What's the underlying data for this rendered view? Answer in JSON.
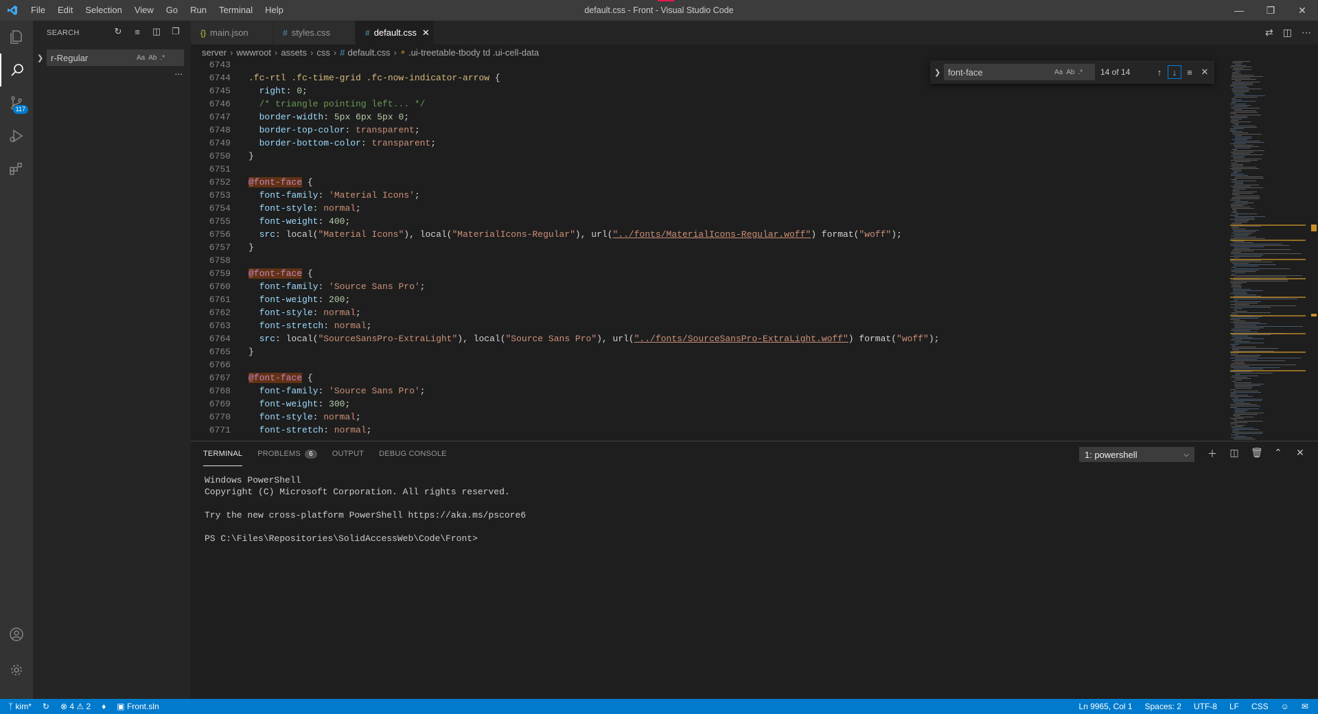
{
  "window": {
    "title": "default.css - Front - Visual Studio Code",
    "menu": [
      "File",
      "Edit",
      "Selection",
      "View",
      "Go",
      "Run",
      "Terminal",
      "Help"
    ]
  },
  "activity_bar": {
    "source_control_badge": "117"
  },
  "sidebar": {
    "header": "SEARCH",
    "search_value": "r-Regular",
    "option_case": "Aa",
    "option_word": "Ab",
    "option_regex": ".*",
    "more": "..."
  },
  "tabs": [
    {
      "label": "main.json",
      "icon": "{}"
    },
    {
      "label": "styles.css",
      "icon": "#"
    },
    {
      "label": "default.css",
      "icon": "#"
    }
  ],
  "breadcrumb": {
    "items": [
      "server",
      "wwwroot",
      "assets",
      "css",
      "default.css",
      ".ui-treetable-tbody td .ui-cell-data"
    ]
  },
  "find_widget": {
    "value": "font-face",
    "count": "14 of 14",
    "option_case": "Aa",
    "option_word": "Ab",
    "option_regex": ".*"
  },
  "editor": {
    "lines": [
      {
        "n": "6743",
        "tokens": []
      },
      {
        "n": "6744",
        "tokens": [
          [
            "sel",
            ".fc-rtl .fc-time-grid .fc-now-indicator-arrow"
          ],
          [
            "pun",
            " {"
          ]
        ]
      },
      {
        "n": "6745",
        "tokens": [
          [
            "pun",
            "  "
          ],
          [
            "prop",
            "right"
          ],
          [
            "pun",
            ": "
          ],
          [
            "num",
            "0"
          ],
          [
            "pun",
            ";"
          ]
        ]
      },
      {
        "n": "6746",
        "tokens": [
          [
            "pun",
            "  "
          ],
          [
            "cmt",
            "/* triangle pointing left... */"
          ]
        ]
      },
      {
        "n": "6747",
        "tokens": [
          [
            "pun",
            "  "
          ],
          [
            "prop",
            "border-width"
          ],
          [
            "pun",
            ": "
          ],
          [
            "num",
            "5px 6px 5px 0"
          ],
          [
            "pun",
            ";"
          ]
        ]
      },
      {
        "n": "6748",
        "tokens": [
          [
            "pun",
            "  "
          ],
          [
            "prop",
            "border-top-color"
          ],
          [
            "pun",
            ": "
          ],
          [
            "str",
            "transparent"
          ],
          [
            "pun",
            ";"
          ]
        ]
      },
      {
        "n": "6749",
        "tokens": [
          [
            "pun",
            "  "
          ],
          [
            "prop",
            "border-bottom-color"
          ],
          [
            "pun",
            ": "
          ],
          [
            "str",
            "transparent"
          ],
          [
            "pun",
            ";"
          ]
        ]
      },
      {
        "n": "6750",
        "tokens": [
          [
            "pun",
            "}"
          ]
        ]
      },
      {
        "n": "6751",
        "tokens": []
      },
      {
        "n": "6752",
        "tokens": [
          [
            "at",
            "@font-face"
          ],
          [
            "pun",
            " {"
          ]
        ]
      },
      {
        "n": "6753",
        "tokens": [
          [
            "pun",
            "  "
          ],
          [
            "prop",
            "font-family"
          ],
          [
            "pun",
            ": "
          ],
          [
            "str",
            "'Material Icons'"
          ],
          [
            "pun",
            ";"
          ]
        ]
      },
      {
        "n": "6754",
        "tokens": [
          [
            "pun",
            "  "
          ],
          [
            "prop",
            "font-style"
          ],
          [
            "pun",
            ": "
          ],
          [
            "str",
            "normal"
          ],
          [
            "pun",
            ";"
          ]
        ]
      },
      {
        "n": "6755",
        "tokens": [
          [
            "pun",
            "  "
          ],
          [
            "prop",
            "font-weight"
          ],
          [
            "pun",
            ": "
          ],
          [
            "num",
            "400"
          ],
          [
            "pun",
            ";"
          ]
        ]
      },
      {
        "n": "6756",
        "tokens": [
          [
            "pun",
            "  "
          ],
          [
            "prop",
            "src"
          ],
          [
            "pun",
            ": local("
          ],
          [
            "str",
            "\"Material Icons\""
          ],
          [
            "pun",
            "), local("
          ],
          [
            "str",
            "\"MaterialIcons-Regular\""
          ],
          [
            "pun",
            "), url("
          ],
          [
            "url",
            "\"../fonts/MaterialIcons-Regular.woff\""
          ],
          [
            "pun",
            ") format("
          ],
          [
            "str",
            "\"woff\""
          ],
          [
            "pun",
            ");"
          ]
        ]
      },
      {
        "n": "6757",
        "tokens": [
          [
            "pun",
            "}"
          ]
        ]
      },
      {
        "n": "6758",
        "tokens": []
      },
      {
        "n": "6759",
        "tokens": [
          [
            "at",
            "@font-face"
          ],
          [
            "pun",
            " {"
          ]
        ]
      },
      {
        "n": "6760",
        "tokens": [
          [
            "pun",
            "  "
          ],
          [
            "prop",
            "font-family"
          ],
          [
            "pun",
            ": "
          ],
          [
            "str",
            "'Source Sans Pro'"
          ],
          [
            "pun",
            ";"
          ]
        ]
      },
      {
        "n": "6761",
        "tokens": [
          [
            "pun",
            "  "
          ],
          [
            "prop",
            "font-weight"
          ],
          [
            "pun",
            ": "
          ],
          [
            "num",
            "200"
          ],
          [
            "pun",
            ";"
          ]
        ]
      },
      {
        "n": "6762",
        "tokens": [
          [
            "pun",
            "  "
          ],
          [
            "prop",
            "font-style"
          ],
          [
            "pun",
            ": "
          ],
          [
            "str",
            "normal"
          ],
          [
            "pun",
            ";"
          ]
        ]
      },
      {
        "n": "6763",
        "tokens": [
          [
            "pun",
            "  "
          ],
          [
            "prop",
            "font-stretch"
          ],
          [
            "pun",
            ": "
          ],
          [
            "str",
            "normal"
          ],
          [
            "pun",
            ";"
          ]
        ]
      },
      {
        "n": "6764",
        "tokens": [
          [
            "pun",
            "  "
          ],
          [
            "prop",
            "src"
          ],
          [
            "pun",
            ": local("
          ],
          [
            "str",
            "\"SourceSansPro-ExtraLight\""
          ],
          [
            "pun",
            "), local("
          ],
          [
            "str",
            "\"Source Sans Pro\""
          ],
          [
            "pun",
            "), url("
          ],
          [
            "url",
            "\"../fonts/SourceSansPro-ExtraLight.woff\""
          ],
          [
            "pun",
            ") format("
          ],
          [
            "str",
            "\"woff\""
          ],
          [
            "pun",
            ");"
          ]
        ]
      },
      {
        "n": "6765",
        "tokens": [
          [
            "pun",
            "}"
          ]
        ]
      },
      {
        "n": "6766",
        "tokens": []
      },
      {
        "n": "6767",
        "tokens": [
          [
            "at",
            "@font-face"
          ],
          [
            "pun",
            " {"
          ]
        ]
      },
      {
        "n": "6768",
        "tokens": [
          [
            "pun",
            "  "
          ],
          [
            "prop",
            "font-family"
          ],
          [
            "pun",
            ": "
          ],
          [
            "str",
            "'Source Sans Pro'"
          ],
          [
            "pun",
            ";"
          ]
        ]
      },
      {
        "n": "6769",
        "tokens": [
          [
            "pun",
            "  "
          ],
          [
            "prop",
            "font-weight"
          ],
          [
            "pun",
            ": "
          ],
          [
            "num",
            "300"
          ],
          [
            "pun",
            ";"
          ]
        ]
      },
      {
        "n": "6770",
        "tokens": [
          [
            "pun",
            "  "
          ],
          [
            "prop",
            "font-style"
          ],
          [
            "pun",
            ": "
          ],
          [
            "str",
            "normal"
          ],
          [
            "pun",
            ";"
          ]
        ]
      },
      {
        "n": "6771",
        "tokens": [
          [
            "pun",
            "  "
          ],
          [
            "prop",
            "font-stretch"
          ],
          [
            "pun",
            ": "
          ],
          [
            "str",
            "normal"
          ],
          [
            "pun",
            ";"
          ]
        ]
      }
    ]
  },
  "panel": {
    "tabs": [
      "TERMINAL",
      "PROBLEMS",
      "OUTPUT",
      "DEBUG CONSOLE"
    ],
    "problems_count": "6",
    "terminal_select": "1: powershell",
    "terminal_lines": [
      "Windows PowerShell",
      "Copyright (C) Microsoft Corporation. All rights reserved.",
      "",
      "Try the new cross-platform PowerShell https://aka.ms/pscore6",
      "",
      "PS C:\\Files\\Repositories\\SolidAccessWeb\\Code\\Front>"
    ]
  },
  "status_bar": {
    "branch": "kim*",
    "errors": "4",
    "warnings": "2",
    "solution": "Front.sln",
    "position": "Ln 9965, Col 1",
    "spaces": "Spaces: 2",
    "encoding": "UTF-8",
    "eol": "LF",
    "language": "CSS"
  },
  "colors": {
    "accent": "#007acc",
    "titlebar": "#3c3c3c",
    "editor_bg": "#1e1e1e"
  }
}
